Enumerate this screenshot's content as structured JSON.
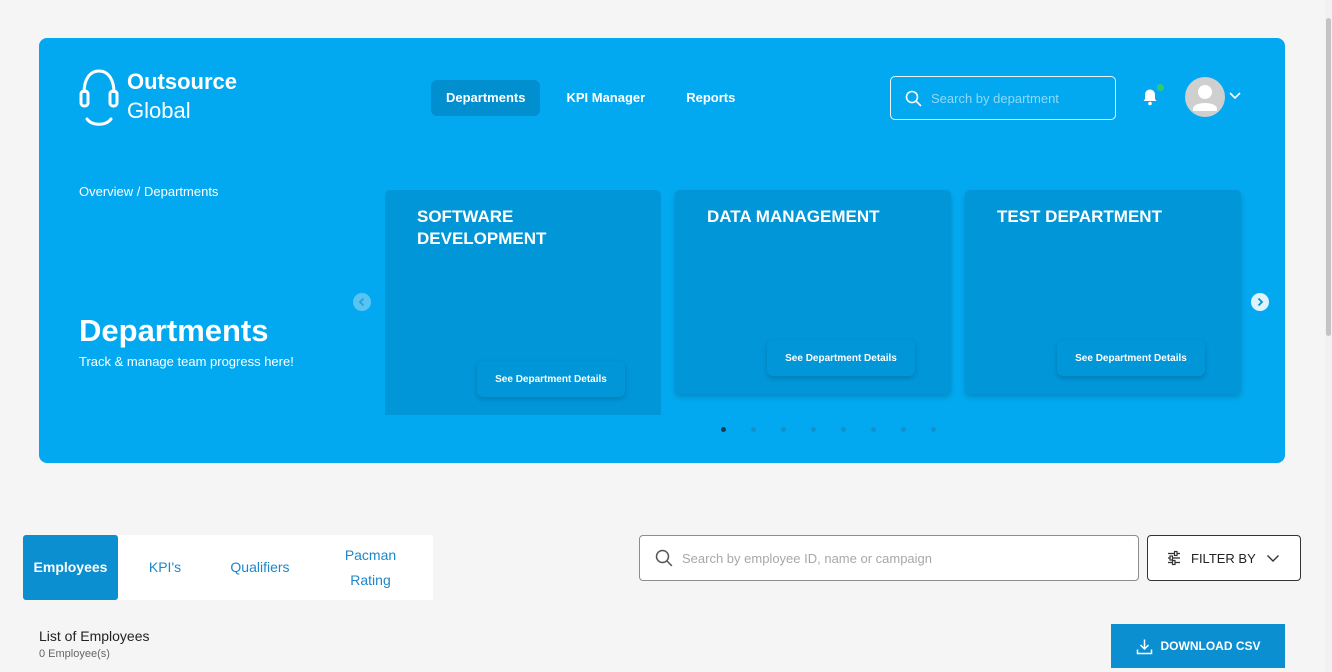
{
  "brand": {
    "line1": "Outsource",
    "line2": "Global"
  },
  "nav": {
    "items": [
      {
        "label": "Departments",
        "active": true
      },
      {
        "label": "KPI Manager",
        "active": false
      },
      {
        "label": "Reports",
        "active": false
      }
    ]
  },
  "header_search": {
    "placeholder": "Search by department",
    "value": ""
  },
  "notifications": {
    "has_unread": true,
    "unread_color": "#2ecc71"
  },
  "hero": {
    "breadcrumb": "Overview / Departments",
    "title": "Departments",
    "subtitle": "Track & manage team progress here!"
  },
  "departments": [
    {
      "name": "SOFTWARE DEVELOPMENT",
      "button": "See Department Details"
    },
    {
      "name": "DATA MANAGEMENT",
      "button": "See Department Details"
    },
    {
      "name": "TEST DEPARTMENT",
      "button": "See Department Details"
    }
  ],
  "carousel": {
    "page_count": 8,
    "active_page": 1
  },
  "tabs": [
    {
      "label": "Employees",
      "active": true
    },
    {
      "label": "KPI's",
      "active": false
    },
    {
      "label": "Qualifiers",
      "active": false
    },
    {
      "label": "Pacman Rating",
      "active": false
    }
  ],
  "employee_search": {
    "placeholder": "Search by employee ID, name or campaign",
    "value": ""
  },
  "filter": {
    "label": "FILTER BY"
  },
  "list": {
    "title": "List of Employees",
    "count": "0 Employee(s)"
  },
  "download": {
    "label": "DOWNLOAD CSV"
  },
  "colors": {
    "hero": "#03a9f0",
    "card": "#0196d8",
    "accent": "#0b8fd0",
    "page_bg": "#f5f5f5"
  }
}
